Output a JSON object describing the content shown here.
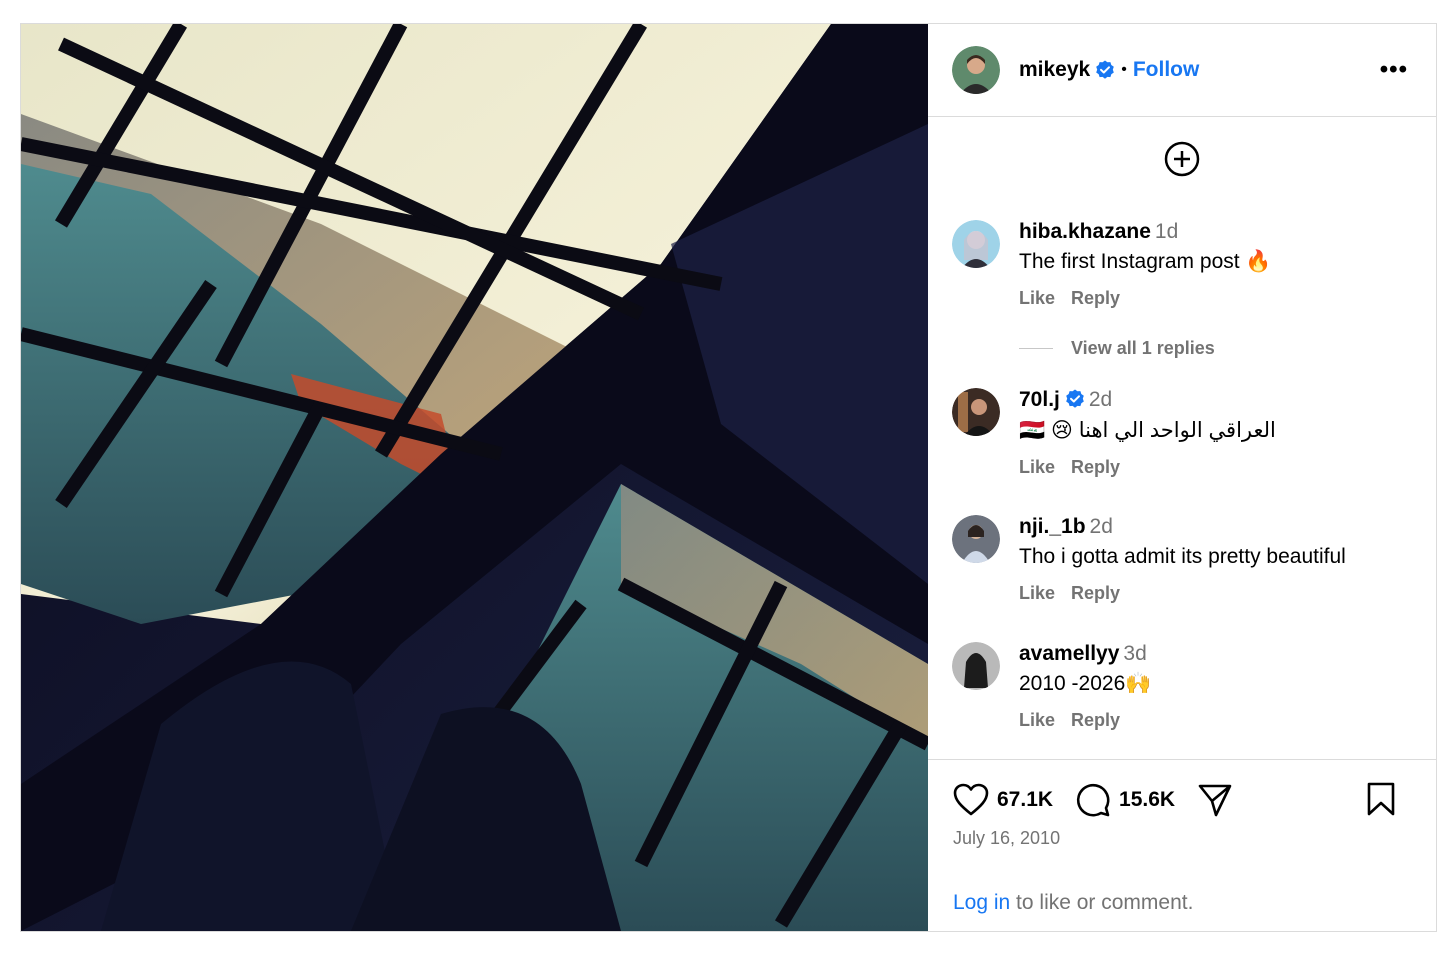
{
  "post": {
    "username": "mikeyk",
    "follow_label": "Follow",
    "separator": "•",
    "more_label": "•••",
    "photo_alt": "Photo"
  },
  "comments": [
    {
      "username": "hiba.khazane",
      "time": "1d",
      "text": "The first Instagram post 🔥",
      "like": "Like",
      "reply": "Reply",
      "verified": false
    },
    {
      "username": "70l.j",
      "time": "2d",
      "text": "🇮🇶 😢 العراقي الواحد الي اهنا",
      "like": "Like",
      "reply": "Reply",
      "verified": true
    },
    {
      "username": "nji._1b",
      "time": "2d",
      "text": "Tho i gotta admit its pretty beautiful",
      "like": "Like",
      "reply": "Reply",
      "verified": false
    },
    {
      "username": "avamellyy",
      "time": "3d",
      "text": "2010 -2026🙌",
      "like": "Like",
      "reply": "Reply",
      "verified": false
    }
  ],
  "view_replies": "View all 1 replies",
  "stats": {
    "likes": "67.1K",
    "comments": "15.6K"
  },
  "date": "July 16, 2010",
  "login": {
    "link": "Log in",
    "rest": " to like or comment."
  },
  "colors": {
    "link": "#1877f2",
    "secondary_text": "#737373",
    "border": "#dbdbdb",
    "verified": "#1877f2"
  }
}
